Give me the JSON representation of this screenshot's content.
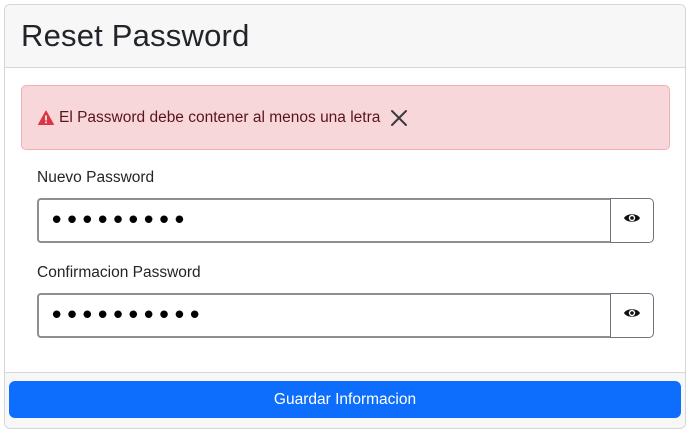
{
  "card": {
    "title": "Reset Password"
  },
  "alert": {
    "icon": "warning-triangle-icon",
    "message": "El Password debe contener al menos una letra",
    "close_icon": "close-icon",
    "colors": {
      "background": "#f8d7da",
      "border": "#f1aeb5",
      "text": "#58151c",
      "icon": "#dc3545"
    }
  },
  "form": {
    "new_password": {
      "label": "Nuevo Password",
      "value": "•••••••••",
      "toggle_icon": "eye-icon"
    },
    "confirm_password": {
      "label": "Confirmacion Password",
      "value": "••••••••••",
      "toggle_icon": "eye-icon"
    }
  },
  "footer": {
    "submit_label": "Guardar Informacion",
    "submit_color": "#0d6efd"
  }
}
